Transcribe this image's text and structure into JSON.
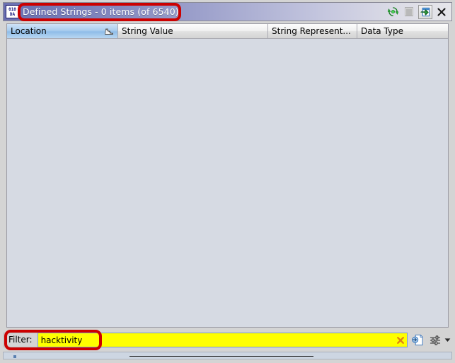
{
  "window": {
    "app_icon_line1": "010",
    "app_icon_line2": "DA",
    "app_icon_name": "hex-data-icon",
    "title": "Defined Strings - 0 items (of 6540)",
    "title_color": "#ffffff",
    "titlebar_accent": "#6a6fb0"
  },
  "titlebar_actions": [
    {
      "name": "refresh-icon",
      "label": "Refresh",
      "color": "#1d9b2e"
    },
    {
      "name": "menu-icon",
      "label": "Table Options",
      "color": "#9a9a9a"
    },
    {
      "name": "snapshot-icon",
      "label": "Snapshot Window",
      "color": "#2a6fbb"
    },
    {
      "name": "close-icon",
      "label": "Close",
      "color": "#1a1a1a"
    }
  ],
  "table": {
    "columns": [
      {
        "label": "Location",
        "sorted": true,
        "sort_icon": "sort-ascending-icon"
      },
      {
        "label": "String Value",
        "sorted": false
      },
      {
        "label": "String Represent...",
        "sorted": false
      },
      {
        "label": "Data Type",
        "sorted": false
      }
    ],
    "rows": [],
    "row_count": 0,
    "total_count": 6540,
    "empty_background": "#d6dae3"
  },
  "filter": {
    "label": "Filter:",
    "value": "hacktivity",
    "placeholder": "",
    "field_background": "#ffff00",
    "clear_icon": "clear-x-icon",
    "clear_color": "#e08214",
    "tools": [
      {
        "name": "filter-text-options-icon",
        "label": "Filter Text Options"
      },
      {
        "name": "filter-settings-icon",
        "label": "Column Filters"
      },
      {
        "name": "filter-dropdown-arrow-icon",
        "label": "Open Filter Options"
      }
    ]
  },
  "annotations": [
    {
      "name": "annotation-title",
      "color": "#cc0000",
      "target": "Defined Strings - 0 items (of 6540)"
    },
    {
      "name": "annotation-filter",
      "color": "#cc0000",
      "target": "hacktivity"
    }
  ]
}
